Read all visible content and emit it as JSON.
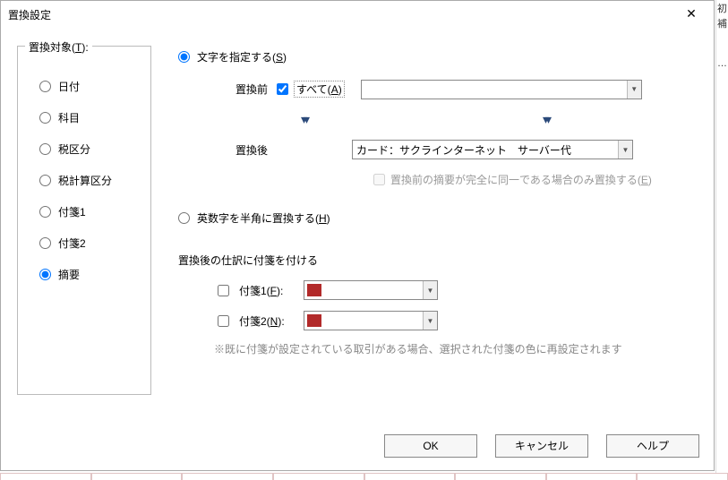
{
  "window": {
    "title": "置換設定",
    "close": "✕"
  },
  "target_group": {
    "legend": "置換対象(T):",
    "items": [
      {
        "label": "日付",
        "checked": false
      },
      {
        "label": "科目",
        "checked": false
      },
      {
        "label": "税区分",
        "checked": false
      },
      {
        "label": "税計算区分",
        "checked": false
      },
      {
        "label": "付箋1",
        "checked": false
      },
      {
        "label": "付箋2",
        "checked": false
      },
      {
        "label": "摘要",
        "checked": true
      }
    ]
  },
  "mode": {
    "specify_text": {
      "label": "文字を指定する(S)",
      "checked": true
    },
    "halfwidth": {
      "label": "英数字を半角に置換する(H)",
      "checked": false
    }
  },
  "before": {
    "label": "置換前",
    "all_checked": true,
    "all_label": "すべて(A)",
    "value": ""
  },
  "after": {
    "label": "置換後",
    "value": "カード：サクラインターネット　サーバー代",
    "only_exact": {
      "checked": false,
      "label": "置換前の摘要が完全に同一である場合のみ置換する(E)"
    }
  },
  "fusen_section": {
    "title": "置換後の仕訳に付箋を付ける",
    "f1": {
      "checked": false,
      "label": "付箋1(F):",
      "color": "#b22a2a"
    },
    "f2": {
      "checked": false,
      "label": "付箋2(N):",
      "color": "#b22a2a"
    },
    "note": "※既に付箋が設定されている取引がある場合、選択された付箋の色に再設定されます"
  },
  "buttons": {
    "ok": "OK",
    "cancel": "キャンセル",
    "help": "ヘルプ"
  },
  "strip": {
    "a": "初",
    "b": "補"
  }
}
